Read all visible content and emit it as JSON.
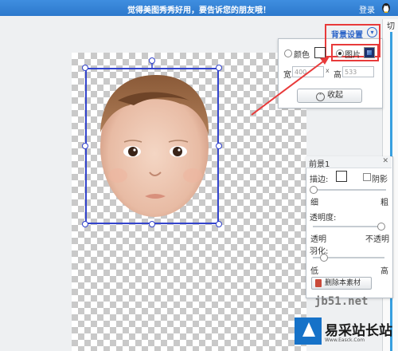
{
  "topbar": {
    "message": "觉得美图秀秀好用，要告诉您的朋友哦！",
    "login": "登录"
  },
  "background_panel": {
    "title": "背景设置",
    "option_color": "颜色",
    "option_image": "图片",
    "selected_option": "图片",
    "width_label": "宽",
    "width_value": "400",
    "height_label": "高",
    "height_value": "533",
    "times_sign": "x",
    "collapse_button": "收起"
  },
  "side_tab": {
    "label": "切"
  },
  "foreground_panel": {
    "title": "前景1",
    "stroke_label": "描边:",
    "shadow_label": "阴影",
    "stroke_min": "细",
    "stroke_max": "粗",
    "opacity_label": "透明度:",
    "opacity_min": "透明",
    "opacity_max": "不透明",
    "feather_label": "羽化:",
    "feather_min": "低",
    "feather_max": "高",
    "delete_button": "删除本素材"
  },
  "watermark": {
    "site": "jb51.net",
    "logo_text": "易采站长站",
    "logo_sub": "Www.Easck.Com"
  },
  "colors": {
    "accent": "#2a63c8",
    "highlight": "#e83a3a",
    "selection": "#3344cc",
    "banner": "#2c78cc"
  }
}
